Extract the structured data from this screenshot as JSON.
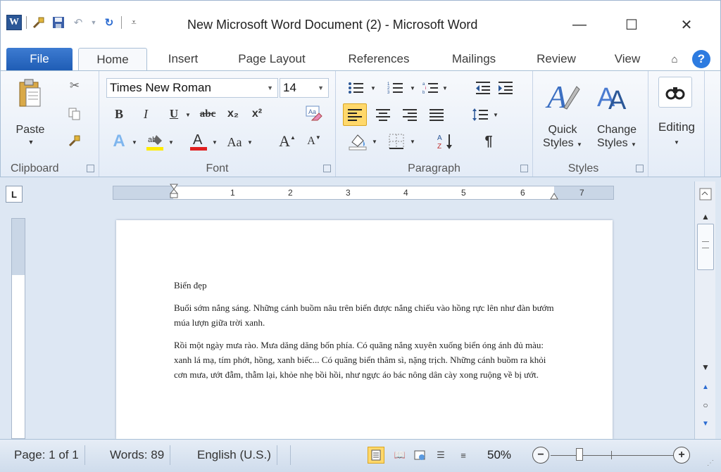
{
  "window": {
    "title": "New Microsoft Word Document (2)  -  Microsoft Word",
    "minimize": "—",
    "maximize": "☐",
    "close": "✕"
  },
  "quick_access": {
    "app_icon": "W",
    "format_painter": "🖌",
    "save": "💾",
    "undo": "↶",
    "redo": "↻",
    "customize": "⩡"
  },
  "tabs": [
    "File",
    "Home",
    "Insert",
    "Page Layout",
    "References",
    "Mailings",
    "Review",
    "View"
  ],
  "ribbon": {
    "clipboard": {
      "label": "Clipboard",
      "paste": "Paste"
    },
    "font": {
      "label": "Font",
      "family": "Times New Roman",
      "size": "14",
      "bold": "B",
      "italic": "I",
      "underline": "U",
      "strike": "abc",
      "subscript": "x₂",
      "superscript": "x²",
      "change_case": "Aa",
      "grow": "A",
      "shrink": "A"
    },
    "paragraph": {
      "label": "Paragraph",
      "pilcrow": "¶"
    },
    "styles": {
      "label": "Styles",
      "quick_styles": "Quick Styles",
      "change_styles": "Change Styles"
    },
    "editing": {
      "label": "Editing"
    }
  },
  "ruler": {
    "numbers": [
      "1",
      "2",
      "3",
      "4",
      "5",
      "6",
      "7"
    ],
    "tab_selector": "L"
  },
  "document": {
    "title": "Biển đẹp",
    "para1": "Buổi sớm nắng sáng. Những cánh buồm nâu trên biển được nắng chiếu vào hồng rực lên như đàn bướm múa lượn giữa trời xanh.",
    "para2": "Rồi một ngày mưa rào. Mưa dăng dăng bốn phía. Có quãng nắng xuyên xuống biển óng ánh đủ màu: xanh lá mạ, tím phớt, hồng, xanh biếc... Có quãng biển thâm sì, nặng trịch. Những cánh buồm ra khỏi cơn mưa, ướt đẫm, thẫm lại, khỏe nhẹ bồi hồi, như ngực áo bác nông dân cày xong ruộng về bị ướt."
  },
  "status": {
    "page": "Page: 1 of 1",
    "words": "Words: 89",
    "language": "English (U.S.)",
    "zoom": "50%"
  },
  "colors": {
    "accent": "#2b5797",
    "file_tab": "#2a6bc9",
    "highlight": "#ffd86b"
  }
}
